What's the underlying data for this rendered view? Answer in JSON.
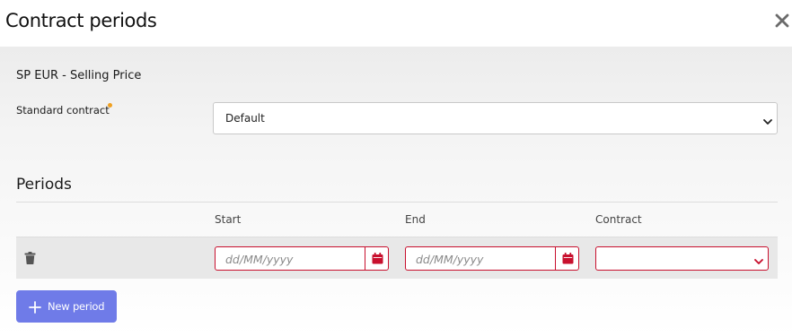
{
  "dialog": {
    "title": "Contract periods",
    "close_icon": "close-icon"
  },
  "price_list": {
    "label": "SP EUR - Selling Price"
  },
  "standard_contract": {
    "label": "Standard contract",
    "required": true,
    "required_color": "#f0a020",
    "selected": "Default"
  },
  "periods": {
    "title": "Periods",
    "columns": [
      "Start",
      "End",
      "Contract"
    ],
    "rows": [
      {
        "start_placeholder": "dd/MM/yyyy",
        "end_placeholder": "dd/MM/yyyy",
        "contract": ""
      }
    ],
    "invalid_color": "#c8102e"
  },
  "new_period_button": {
    "label": "New period",
    "icon": "plus-icon",
    "color": "#6f7be8"
  }
}
